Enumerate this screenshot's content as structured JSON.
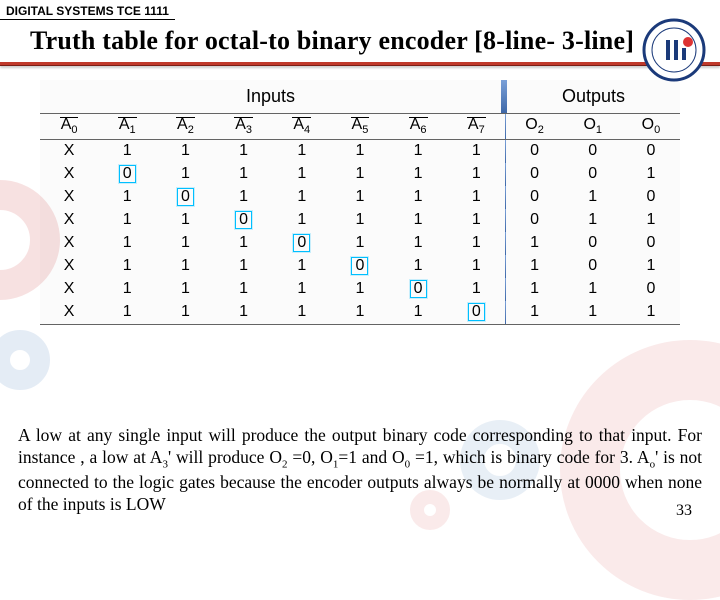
{
  "course_tag": "DIGITAL SYSTEMS TCE 1111",
  "title": "Truth table for octal-to binary encoder [8-line- 3-line]",
  "section_labels": {
    "inputs": "Inputs",
    "outputs": "Outputs"
  },
  "headers": {
    "in": [
      "A",
      "A",
      "A",
      "A",
      "A",
      "A",
      "A",
      "A"
    ],
    "in_sub": [
      "0",
      "1",
      "2",
      "3",
      "4",
      "5",
      "6",
      "7"
    ],
    "out": [
      "O",
      "O",
      "O"
    ],
    "out_sub": [
      "2",
      "1",
      "0"
    ]
  },
  "rows": [
    {
      "in": [
        "X",
        "1",
        "1",
        "1",
        "1",
        "1",
        "1",
        "1"
      ],
      "out": [
        "0",
        "0",
        "0"
      ],
      "lowcol": -1
    },
    {
      "in": [
        "X",
        "0",
        "1",
        "1",
        "1",
        "1",
        "1",
        "1"
      ],
      "out": [
        "0",
        "0",
        "1"
      ],
      "lowcol": 1
    },
    {
      "in": [
        "X",
        "1",
        "0",
        "1",
        "1",
        "1",
        "1",
        "1"
      ],
      "out": [
        "0",
        "1",
        "0"
      ],
      "lowcol": 2
    },
    {
      "in": [
        "X",
        "1",
        "1",
        "0",
        "1",
        "1",
        "1",
        "1"
      ],
      "out": [
        "0",
        "1",
        "1"
      ],
      "lowcol": 3
    },
    {
      "in": [
        "X",
        "1",
        "1",
        "1",
        "0",
        "1",
        "1",
        "1"
      ],
      "out": [
        "1",
        "0",
        "0"
      ],
      "lowcol": 4
    },
    {
      "in": [
        "X",
        "1",
        "1",
        "1",
        "1",
        "0",
        "1",
        "1"
      ],
      "out": [
        "1",
        "0",
        "1"
      ],
      "lowcol": 5
    },
    {
      "in": [
        "X",
        "1",
        "1",
        "1",
        "1",
        "1",
        "0",
        "1"
      ],
      "out": [
        "1",
        "1",
        "0"
      ],
      "lowcol": 6
    },
    {
      "in": [
        "X",
        "1",
        "1",
        "1",
        "1",
        "1",
        "1",
        "0"
      ],
      "out": [
        "1",
        "1",
        "1"
      ],
      "lowcol": 7
    }
  ],
  "explain_parts": {
    "p1": "A low at any single input will produce the output binary code corresponding to that input. For instance , a low at A",
    "p1s": "3",
    "p2": "' will produce O",
    "p2s": "2",
    "p3": " =0, O",
    "p3s": "1",
    "p4": "=1 and O",
    "p4s": "0",
    "p5": " =1, which is binary code for 3. A",
    "p5s": "o",
    "p6": "' is not connected to the logic gates because the encoder outputs always be normally at 0000 when none of the inputs is LOW"
  },
  "page_number": "33"
}
